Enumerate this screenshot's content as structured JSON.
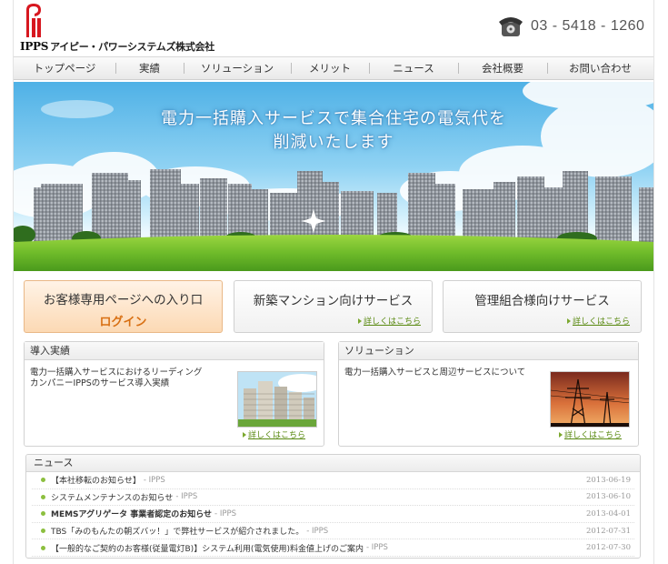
{
  "header": {
    "logo_ipps": "IPPS",
    "logo_company": "アイピー・パワーシステムズ株式会社",
    "phone_number": "03 - 5418 - 1260"
  },
  "nav": {
    "items": [
      {
        "label": "トップページ"
      },
      {
        "label": "実績"
      },
      {
        "label": "ソリューション"
      },
      {
        "label": "メリット"
      },
      {
        "label": "ニュース"
      },
      {
        "label": "会社概要"
      },
      {
        "label": "お問い合わせ"
      }
    ]
  },
  "hero": {
    "line1": "電力一括購入サービスで集合住宅の電気代を",
    "line2": "削減いたします"
  },
  "services": {
    "login_title": "お客様専用ページへの入り口",
    "login_button": "ログイン",
    "new_mansion_title": "新築マンション向けサービス",
    "management_title": "管理組合様向けサービス",
    "more_label": "詳しくはこちら"
  },
  "panels": {
    "results": {
      "title": "導入実績",
      "text_line1": "電力一括購入サービスにおけるリーディング",
      "text_line2": "カンパニーIPPSのサービス導入実績",
      "more_label": "詳しくはこちら"
    },
    "solutions": {
      "title": "ソリューション",
      "text_line1": "電力一括購入サービスと周辺サービスについて",
      "more_label": "詳しくはこちら"
    }
  },
  "news": {
    "title": "ニュース",
    "items": [
      {
        "title": "【本社移転のお知らせ】",
        "source": "- IPPS",
        "date": "2013-06-19",
        "bold": false
      },
      {
        "title": "システムメンテナンスのお知らせ",
        "source": "- IPPS",
        "date": "2013-06-10",
        "bold": false
      },
      {
        "title": "MEMSアグリゲータ 事業者認定のお知らせ",
        "source": "- IPPS",
        "date": "2013-04-01",
        "bold": true
      },
      {
        "title": "TBS「みのもんたの朝ズバッ！」で弊社サービスが紹介されました。",
        "source": "- IPPS",
        "date": "2012-07-31",
        "bold": false
      },
      {
        "title": "【一般的なご契約のお客様(従量電灯B)】システム利用(電気使用)料金値上げのご案内",
        "source": "- IPPS",
        "date": "2012-07-30",
        "bold": false
      }
    ]
  },
  "colors": {
    "accent_orange": "#d86f12",
    "link_green": "#5a8a12",
    "logo_red": "#d7171f"
  }
}
